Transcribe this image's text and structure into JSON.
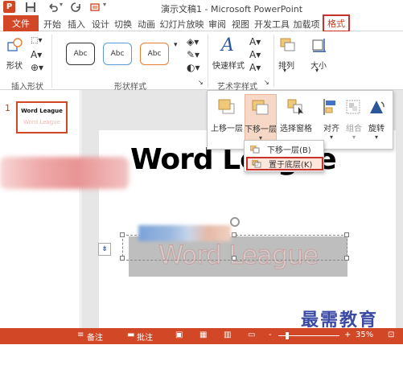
{
  "window": {
    "title": "演示文稿1 - Microsoft PowerPoint",
    "app_logo": "P"
  },
  "quick_access": {
    "save_icon": "save-icon",
    "undo_icon": "undo-icon",
    "redo_icon": "redo-icon",
    "customize_icon": "customize-icon"
  },
  "tabs": [
    {
      "label": "文件",
      "id": "file"
    },
    {
      "label": "开始",
      "id": "home"
    },
    {
      "label": "插入",
      "id": "insert"
    },
    {
      "label": "设计",
      "id": "design"
    },
    {
      "label": "切换",
      "id": "transitions"
    },
    {
      "label": "动画",
      "id": "animations"
    },
    {
      "label": "幻灯片放映",
      "id": "slideshow"
    },
    {
      "label": "审阅",
      "id": "review"
    },
    {
      "label": "视图",
      "id": "view"
    },
    {
      "label": "开发工具",
      "id": "developer"
    },
    {
      "label": "加载项",
      "id": "addins"
    },
    {
      "label": "格式",
      "id": "format"
    }
  ],
  "ribbon": {
    "insert_shapes": {
      "label": "插入形状",
      "shape_label": "形状"
    },
    "shape_styles": {
      "label": "形状样式",
      "samples": [
        "Abc",
        "Abc",
        "Abc"
      ],
      "sample_colors": [
        "#333333",
        "#5b9bd5",
        "#ed7d31"
      ]
    },
    "wordart_styles": {
      "label": "艺术字样式",
      "quick_styles_label": "快速样式"
    },
    "arrange": {
      "label": "排列"
    },
    "size": {
      "label": "大小"
    }
  },
  "arrange_gallery": {
    "buttons": [
      {
        "label": "上移一层",
        "icon": "bring-forward-icon"
      },
      {
        "label": "下移一层",
        "icon": "send-backward-icon"
      },
      {
        "label": "选择窗格",
        "icon": "selection-pane-icon"
      },
      {
        "label": "对齐",
        "icon": "align-icon"
      },
      {
        "label": "组合",
        "icon": "group-icon"
      },
      {
        "label": "旋转",
        "icon": "rotate-icon"
      }
    ]
  },
  "send_backward_menu": {
    "items": [
      {
        "label": "下移一层(B)",
        "icon": "send-backward-small-icon"
      },
      {
        "label": "置于底层(K)",
        "icon": "send-to-back-icon"
      }
    ]
  },
  "thumbnails": {
    "slide_number": "1",
    "title_text": "Word League",
    "wordart_text": "Word League"
  },
  "slide": {
    "title": "Word League",
    "wordart": "Word League",
    "layout_options_icon": "layout-options-icon"
  },
  "statusbar": {
    "notes_label": "备注",
    "comments_label": "批注",
    "zoom_minus": "-",
    "zoom_plus": "+",
    "zoom_level": "35%",
    "zoom_value": 0.35
  },
  "watermark": "最需教育",
  "colors": {
    "accent": "#d24726",
    "highlight_border": "#c8322b",
    "selected_fill": "#f7d8c6"
  }
}
